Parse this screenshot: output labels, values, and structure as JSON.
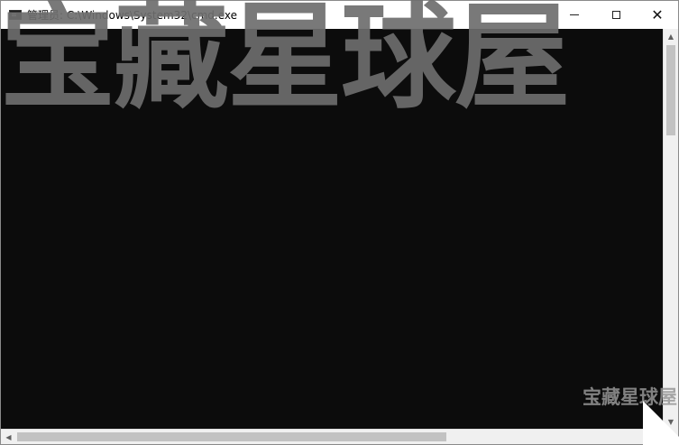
{
  "window": {
    "title": "管理员: C:\\Windows\\System32\\cmd.exe",
    "controls": {
      "minimize": "minimize",
      "maximize": "maximize",
      "close": "✕"
    }
  },
  "console": {
    "lines": []
  },
  "watermark": {
    "large": "宝藏星球屋",
    "small": "宝藏星球屋"
  },
  "colors": {
    "console_bg": "#0c0c0c",
    "titlebar_bg": "#ffffff",
    "scrollbar_bg": "#f0f0f0",
    "scrollbar_thumb": "#c2c2c2"
  },
  "icons": {
    "app": "cmd-icon",
    "minimize": "minimize-icon",
    "maximize": "maximize-icon",
    "close": "close-icon",
    "scroll_up": "chevron-up-icon",
    "scroll_down": "chevron-down-icon",
    "scroll_left": "chevron-left-icon",
    "scroll_right": "chevron-right-icon"
  }
}
